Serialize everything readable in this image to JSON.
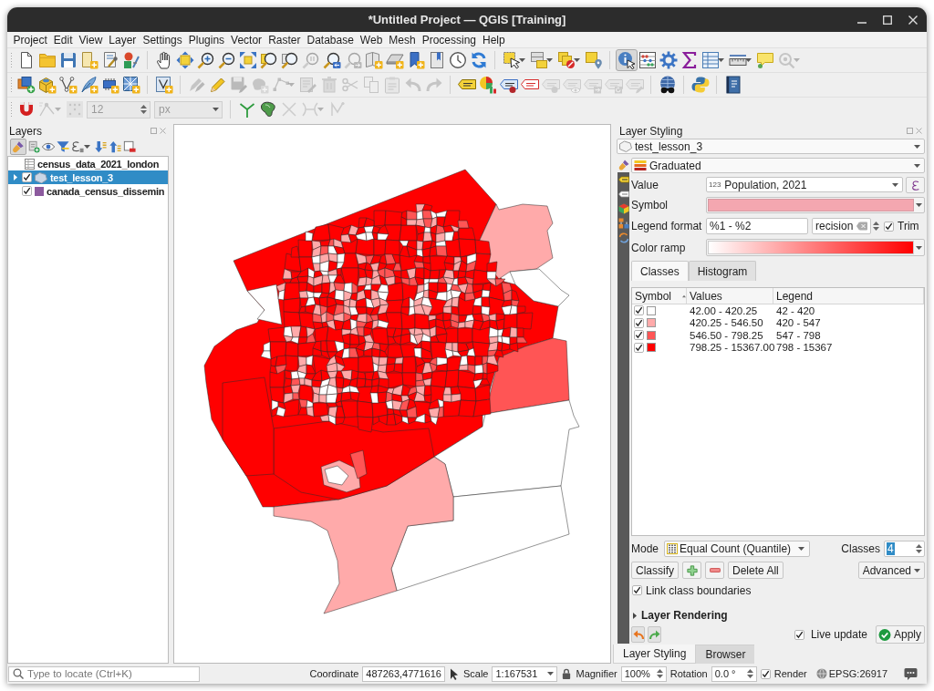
{
  "window": {
    "title": "*Untitled Project — QGIS [Training]"
  },
  "menu": [
    "Project",
    "Edit",
    "View",
    "Layer",
    "Settings",
    "Plugins",
    "Vector",
    "Raster",
    "Database",
    "Web",
    "Mesh",
    "Processing",
    "Help"
  ],
  "toolbars": [
    {
      "groups": [
        [
          {
            "kind": "button",
            "disabled": false,
            "on": false
          },
          {
            "kind": "button",
            "disabled": false,
            "on": false
          },
          {
            "kind": "button",
            "disabled": false,
            "on": false
          },
          {
            "kind": "button",
            "disabled": false,
            "on": false
          },
          {
            "kind": "button",
            "disabled": false,
            "on": false
          },
          {
            "kind": "button",
            "disabled": false,
            "on": false
          }
        ],
        [
          {
            "kind": "button",
            "disabled": false,
            "on": false
          },
          {
            "kind": "button",
            "disabled": false,
            "on": false
          },
          {
            "kind": "button",
            "disabled": false,
            "on": false
          },
          {
            "kind": "button",
            "disabled": false,
            "on": false
          },
          {
            "kind": "button",
            "disabled": false,
            "on": false
          },
          {
            "kind": "button",
            "disabled": false,
            "on": false
          },
          {
            "kind": "button",
            "disabled": false,
            "on": false
          },
          {
            "kind": "button",
            "disabled": true,
            "on": false
          },
          {
            "kind": "button",
            "disabled": false,
            "on": false
          },
          {
            "kind": "button",
            "disabled": true,
            "on": false
          },
          {
            "kind": "button",
            "disabled": false,
            "on": false
          },
          {
            "kind": "button",
            "disabled": false,
            "on": false
          },
          {
            "kind": "button",
            "disabled": false,
            "on": false
          },
          {
            "kind": "button",
            "disabled": false,
            "on": false
          },
          {
            "kind": "button",
            "disabled": false,
            "on": false
          },
          {
            "kind": "button",
            "disabled": false,
            "on": false
          }
        ],
        [
          {
            "kind": "button",
            "disabled": false,
            "on": false
          },
          {
            "kind": "button",
            "disabled": false,
            "on": false
          },
          {
            "kind": "button",
            "disabled": false,
            "on": false
          },
          {
            "kind": "button",
            "disabled": false,
            "on": false
          }
        ],
        [
          {
            "kind": "button",
            "disabled": false,
            "on": true
          },
          {
            "kind": "button",
            "disabled": false,
            "on": false
          },
          {
            "kind": "button",
            "disabled": false,
            "on": false
          },
          {
            "kind": "button",
            "disabled": false,
            "on": false
          },
          {
            "kind": "button",
            "disabled": false,
            "on": false
          },
          {
            "kind": "button",
            "disabled": false,
            "on": false
          },
          {
            "kind": "button",
            "disabled": false,
            "on": false
          },
          {
            "kind": "button",
            "disabled": true,
            "on": false
          }
        ]
      ]
    },
    {
      "groups": [
        [
          {
            "kind": "button",
            "disabled": false,
            "on": false
          },
          {
            "kind": "button",
            "disabled": false,
            "on": false
          },
          {
            "kind": "button",
            "disabled": false,
            "on": false
          },
          {
            "kind": "button",
            "disabled": false,
            "on": false
          },
          {
            "kind": "button",
            "disabled": false,
            "on": false
          },
          {
            "kind": "button",
            "disabled": false,
            "on": false
          }
        ],
        [
          {
            "kind": "button",
            "disabled": false,
            "on": false
          }
        ],
        [
          {
            "kind": "button",
            "disabled": true,
            "on": false
          },
          {
            "kind": "button",
            "disabled": false,
            "on": false
          },
          {
            "kind": "button",
            "disabled": true,
            "on": false
          },
          {
            "kind": "button",
            "disabled": true,
            "on": false
          },
          {
            "kind": "button",
            "disabled": true,
            "on": false
          },
          {
            "kind": "button",
            "disabled": true,
            "on": false
          },
          {
            "kind": "button",
            "disabled": true,
            "on": false
          },
          {
            "kind": "button",
            "disabled": true,
            "on": false
          },
          {
            "kind": "button",
            "disabled": true,
            "on": false
          },
          {
            "kind": "button",
            "disabled": true,
            "on": false
          },
          {
            "kind": "button",
            "disabled": true,
            "on": false
          },
          {
            "kind": "button",
            "disabled": true,
            "on": false
          }
        ],
        [
          {
            "kind": "button",
            "disabled": false,
            "on": false
          },
          {
            "kind": "button",
            "disabled": false,
            "on": false
          },
          {
            "kind": "button",
            "disabled": false,
            "on": false
          },
          {
            "kind": "button",
            "disabled": false,
            "on": false
          },
          {
            "kind": "button",
            "disabled": true,
            "on": false
          },
          {
            "kind": "button",
            "disabled": true,
            "on": false
          },
          {
            "kind": "button",
            "disabled": true,
            "on": false
          },
          {
            "kind": "button",
            "disabled": true,
            "on": false
          },
          {
            "kind": "button",
            "disabled": true,
            "on": false
          }
        ],
        [
          {
            "kind": "button",
            "disabled": false,
            "on": false
          }
        ],
        [
          {
            "kind": "button",
            "disabled": false,
            "on": false
          }
        ],
        [
          {
            "kind": "button",
            "disabled": false,
            "on": false
          }
        ]
      ]
    },
    {
      "groups": [
        [
          {
            "kind": "button",
            "disabled": false,
            "on": false
          },
          {
            "kind": "button",
            "disabled": true,
            "on": false
          },
          {
            "kind": "button",
            "disabled": true,
            "on": false
          },
          {
            "kind": "spinbox",
            "value": "12",
            "disabled": true
          },
          {
            "kind": "combo",
            "value": "px",
            "disabled": true
          }
        ],
        [
          {
            "kind": "button",
            "disabled": false,
            "on": false
          },
          {
            "kind": "button",
            "disabled": false,
            "on": false
          },
          {
            "kind": "button",
            "disabled": true,
            "on": false
          },
          {
            "kind": "button",
            "disabled": true,
            "on": false
          },
          {
            "kind": "button",
            "disabled": true,
            "on": false
          }
        ]
      ]
    }
  ],
  "layers_panel": {
    "title": "Layers",
    "tools": [
      {
        "on": true
      },
      {
        "on": false
      },
      {
        "on": false
      },
      {
        "on": false
      },
      {
        "on": false
      },
      {
        "on": false
      },
      {
        "on": false
      },
      {
        "on": false
      }
    ],
    "tree": [
      {
        "kind": "table",
        "name": "census_data_2021_london",
        "selected": false
      },
      {
        "kind": "graduated",
        "name": "test_lesson_3",
        "selected": true,
        "checked": true,
        "expanded": false
      },
      {
        "kind": "fill",
        "name": "canada_census_dissemin",
        "selected": false,
        "checked": true,
        "color": "#8c5a9e"
      }
    ]
  },
  "styling": {
    "title": "Layer Styling",
    "layer": "test_lesson_3",
    "side_tabs": [
      {
        "selected": true
      },
      {
        "selected": false
      },
      {
        "selected": false
      },
      {
        "selected": false
      },
      {
        "selected": false
      },
      {
        "selected": false
      }
    ],
    "renderer": "Graduated",
    "value": {
      "label": "Value",
      "field_type": "123",
      "field": "Population, 2021"
    },
    "symbol": {
      "label": "Symbol"
    },
    "legend_format": {
      "label": "Legend format",
      "value": "%1 - %2",
      "precision": "recision",
      "trim": {
        "label": "Trim",
        "checked": true
      }
    },
    "color_ramp": {
      "label": "Color ramp"
    },
    "tabs": [
      {
        "label": "Classes",
        "selected": true
      },
      {
        "label": "Histogram",
        "selected": false
      }
    ],
    "columns": [
      {
        "label": "Symbol",
        "sorted": true
      },
      {
        "label": "Values",
        "sorted": false
      },
      {
        "label": "Legend",
        "sorted": false
      }
    ],
    "classes": [
      {
        "checked": true,
        "color": "#ffffff",
        "values": "42.00 - 420.25",
        "legend": "42 - 420"
      },
      {
        "checked": true,
        "color": "#ffaaaa",
        "values": "420.25 - 546.50",
        "legend": "420 - 547"
      },
      {
        "checked": true,
        "color": "#ff5555",
        "values": "546.50 - 798.25",
        "legend": "547 - 798"
      },
      {
        "checked": true,
        "color": "#ff0000",
        "values": "798.25 - 15367.00",
        "legend": "798 - 15367"
      }
    ],
    "mode": {
      "label": "Mode",
      "value": "Equal Count (Quantile)"
    },
    "class_count": {
      "label": "Classes",
      "value": "4"
    },
    "buttons": {
      "classify": "Classify",
      "delete_all": "Delete All",
      "advanced": "Advanced"
    },
    "link_boundaries": {
      "label": "Link class boundaries",
      "checked": true
    },
    "rendering": {
      "label": "Layer Rendering",
      "expanded": false
    },
    "live_update": {
      "label": "Live update",
      "checked": true
    },
    "apply": "Apply"
  },
  "dock_tabs": [
    {
      "label": "Layer Styling",
      "selected": true
    },
    {
      "label": "Browser",
      "selected": false
    }
  ],
  "status_bar": {
    "locator": {
      "placeholder": "Type to locate (Ctrl+K)"
    },
    "coordinate_label": "Coordinate",
    "coordinate": "487263,4771616",
    "scale_label": "Scale",
    "scale": "1:167531",
    "magnifier_label": "Magnifier",
    "magnifier": "100%",
    "rotation_label": "Rotation",
    "rotation": "0.0 °",
    "render": {
      "label": "Render",
      "checked": true
    },
    "crs": "EPSG:26917"
  }
}
